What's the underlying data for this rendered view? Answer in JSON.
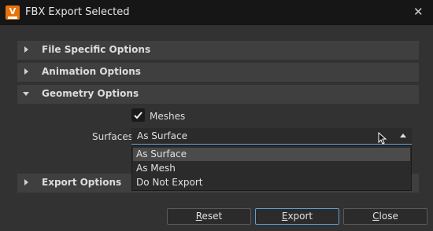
{
  "window": {
    "title": "FBX Export Selected",
    "close_glyph": "✕",
    "app_icon_letter": "V"
  },
  "sections": [
    {
      "label": "File Specific Options",
      "expanded": false
    },
    {
      "label": "Animation Options",
      "expanded": false
    },
    {
      "label": "Geometry Options",
      "expanded": true
    },
    {
      "label": "Export Options",
      "expanded": false
    }
  ],
  "geometry": {
    "meshes_label": "Meshes",
    "meshes_checked": true,
    "surfaces_label": "Surfaces",
    "surfaces_value": "As Surface",
    "surfaces_options": [
      "As Surface",
      "As Mesh",
      "Do Not Export"
    ],
    "surfaces_selected_index": 0
  },
  "buttons": {
    "reset": {
      "first": "R",
      "rest": "eset"
    },
    "export": {
      "first": "E",
      "rest": "xport"
    },
    "close": {
      "first": "C",
      "rest": "lose"
    }
  },
  "colors": {
    "accent": "#5ea0d8",
    "app_icon": "#e8720c"
  }
}
